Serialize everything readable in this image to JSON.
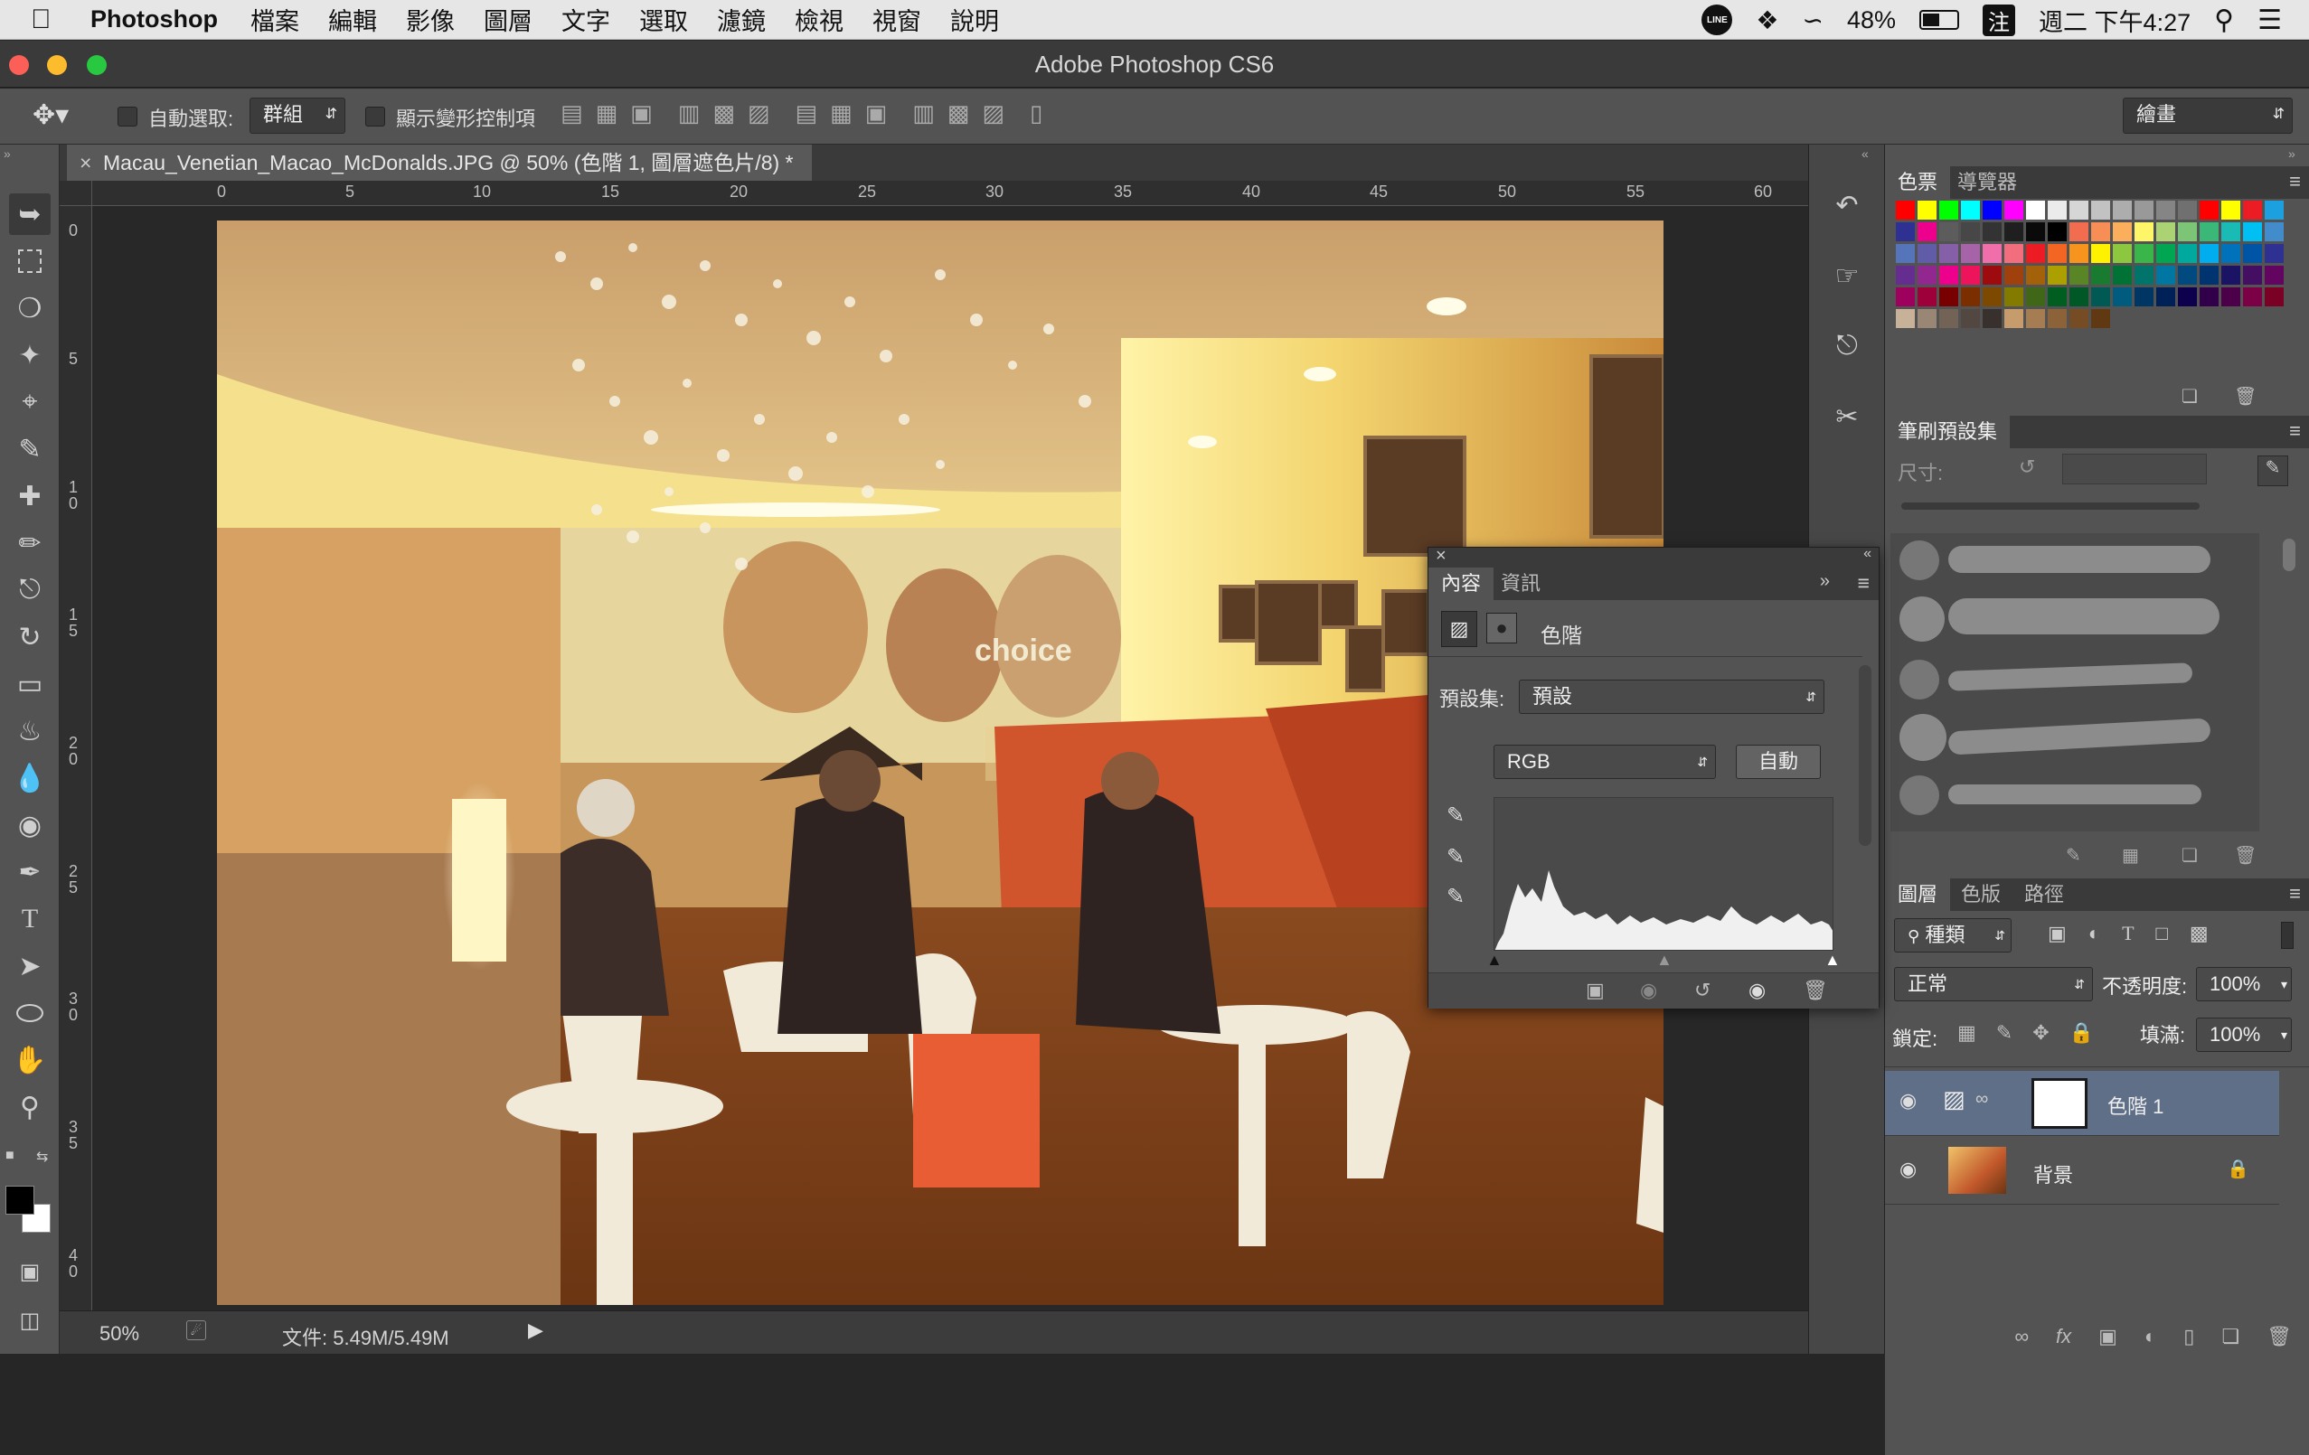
{
  "menubar": {
    "app": "Photoshop",
    "items": [
      "檔案",
      "編輯",
      "影像",
      "圖層",
      "文字",
      "選取",
      "濾鏡",
      "檢視",
      "視窗",
      "說明"
    ],
    "battery": "48%",
    "clock": "週二 下午4:27",
    "input_method": "注"
  },
  "window": {
    "title": "Adobe Photoshop CS6"
  },
  "options": {
    "auto_select_label": "自動選取:",
    "auto_select_value": "群組",
    "show_transform_label": "顯示變形控制項",
    "workspace": "繪畫"
  },
  "document": {
    "tab_title": "Macau_Venetian_Macao_McDonalds.JPG @ 50% (色階 1, 圖層遮色片/8) *",
    "zoom": "50%",
    "file_info": "文件: 5.49M/5.49M"
  },
  "ruler": {
    "h_ticks": [
      "0",
      "5",
      "10",
      "15",
      "20",
      "25",
      "30",
      "35",
      "40",
      "45",
      "50",
      "55",
      "60"
    ],
    "v_ticks": [
      "0",
      "5",
      "10",
      "15",
      "20",
      "25",
      "30",
      "35",
      "40"
    ]
  },
  "photo": {
    "sign_text": "choice"
  },
  "swatches_panel": {
    "tabs": [
      "色票",
      "導覽器"
    ],
    "colors": [
      "#ff0000",
      "#ffff00",
      "#00ff00",
      "#00ffff",
      "#0000ff",
      "#ff00ff",
      "#ffffff",
      "#ebebeb",
      "#d6d6d6",
      "#c2c2c2",
      "#adadad",
      "#999999",
      "#858585",
      "#707070",
      "#ff0000",
      "#ffff00",
      "#eb1c24",
      "#1ca0e0",
      "#2e3192",
      "#ec008c",
      "#5c5c5c",
      "#474747",
      "#333333",
      "#1f1f1f",
      "#0a0a0a",
      "#000000",
      "#f26c4f",
      "#f68e55",
      "#fbaf5d",
      "#fff568",
      "#acd373",
      "#7cc576",
      "#3bb878",
      "#1abbb4",
      "#00bff3",
      "#438ccb",
      "#5574b9",
      "#605ca8",
      "#8560a8",
      "#a763a8",
      "#f06ea9",
      "#f26d7d",
      "#ed1c24",
      "#f26522",
      "#f7941d",
      "#fff200",
      "#8dc73f",
      "#39b54a",
      "#00a651",
      "#00a99d",
      "#00aeef",
      "#0072bc",
      "#0054a6",
      "#2e3192",
      "#662d91",
      "#92278f",
      "#ec008c",
      "#ed145b",
      "#9e0b0f",
      "#a0410d",
      "#a3620a",
      "#aba000",
      "#598527",
      "#197b30",
      "#007236",
      "#00746b",
      "#0076a3",
      "#004a80",
      "#003471",
      "#1b1464",
      "#440e62",
      "#630460",
      "#9e005d",
      "#9e0039",
      "#790000",
      "#7b2e00",
      "#7d4900",
      "#827b00",
      "#406618",
      "#005e20",
      "#005826",
      "#005952",
      "#005b7f",
      "#003663",
      "#002157",
      "#0d004c",
      "#32004b",
      "#4b0049",
      "#7b0046",
      "#7a0026",
      "#c7b299",
      "#998675",
      "#736357",
      "#534741",
      "#37302d",
      "#c69c6d",
      "#a67c52",
      "#8c6239",
      "#754c24",
      "#603913"
    ]
  },
  "brush_panel": {
    "title": "筆刷預設集",
    "size_label": "尺寸:"
  },
  "properties_panel": {
    "tabs": [
      "內容",
      "資訊"
    ],
    "adjustment_name": "色階",
    "preset_label": "預設集:",
    "preset_value": "預設",
    "channel_value": "RGB",
    "auto_button": "自動"
  },
  "layers_panel": {
    "tabs": [
      "圖層",
      "色版",
      "路徑"
    ],
    "filter_kind": "種類",
    "blend_mode": "正常",
    "opacity_label": "不透明度:",
    "opacity_value": "100%",
    "lock_label": "鎖定:",
    "fill_label": "填滿:",
    "fill_value": "100%",
    "layers": [
      {
        "name": "色階 1",
        "selected": true
      },
      {
        "name": "背景",
        "selected": false
      }
    ]
  }
}
